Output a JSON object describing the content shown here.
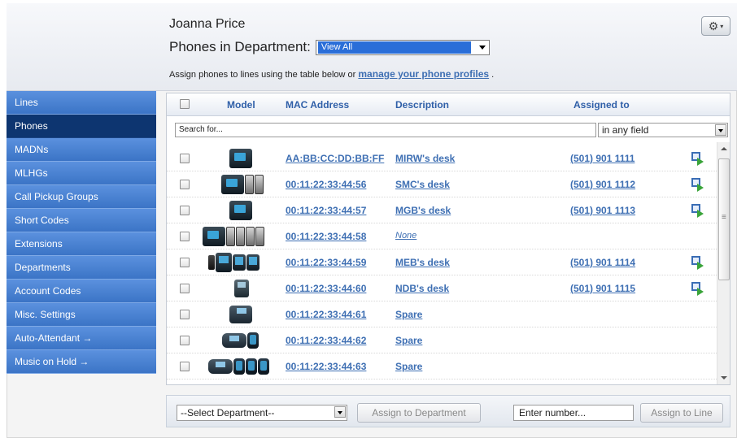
{
  "header": {
    "user_name": "Joanna Price",
    "dept_label": "Phones in Department:",
    "dept_selected": "View All",
    "assign_note": "Assign phones to lines using the table below or",
    "assign_link": "manage your phone profiles",
    "assign_end": ".",
    "gear_icon": "gear-icon"
  },
  "sidebar": {
    "items": [
      {
        "label": "Lines",
        "active": false
      },
      {
        "label": "Phones",
        "active": true
      },
      {
        "label": "MADNs",
        "active": false
      },
      {
        "label": "MLHGs",
        "active": false
      },
      {
        "label": "Call Pickup Groups",
        "active": false
      },
      {
        "label": "Short Codes",
        "active": false
      },
      {
        "label": "Extensions",
        "active": false
      },
      {
        "label": "Departments",
        "active": false
      },
      {
        "label": "Account Codes",
        "active": false
      },
      {
        "label": "Misc. Settings",
        "active": false
      },
      {
        "label": "Auto-Attendant →",
        "active": false
      },
      {
        "label": "Music on Hold →",
        "active": false
      }
    ]
  },
  "table": {
    "columns": {
      "model": "Model",
      "mac": "MAC Address",
      "description": "Description",
      "assigned": "Assigned to"
    },
    "search_placeholder": "Search for...",
    "field_filter": "in any field",
    "rows": [
      {
        "mac": "AA:BB:CC:DD:BB:FF",
        "description": "MIRW's desk",
        "assigned": "(501) 901 1111",
        "forward": true
      },
      {
        "mac": "00:11:22:33:44:56",
        "description": "SMC's desk",
        "assigned": "(501) 901 1112",
        "forward": true
      },
      {
        "mac": "00:11:22:33:44:57",
        "description": "MGB's desk",
        "assigned": "(501) 901 1113",
        "forward": true
      },
      {
        "mac": "00:11:22:33:44:58",
        "description": "None",
        "assigned": "",
        "forward": false
      },
      {
        "mac": "00:11:22:33:44:59",
        "description": "MEB's desk",
        "assigned": "(501) 901 1114",
        "forward": true
      },
      {
        "mac": "00:11:22:33:44:60",
        "description": "NDB's desk",
        "assigned": "(501) 901 1115",
        "forward": true
      },
      {
        "mac": "00:11:22:33:44:61",
        "description": "Spare",
        "assigned": "",
        "forward": false
      },
      {
        "mac": "00:11:22:33:44:62",
        "description": "Spare",
        "assigned": "",
        "forward": false
      },
      {
        "mac": "00:11:22:33:44:63",
        "description": "Spare",
        "assigned": "",
        "forward": false
      }
    ]
  },
  "footer": {
    "dept_select": "--Select Department--",
    "assign_dept_button": "Assign to Department",
    "number_placeholder": "Enter number...",
    "assign_line_button": "Assign to Line"
  }
}
